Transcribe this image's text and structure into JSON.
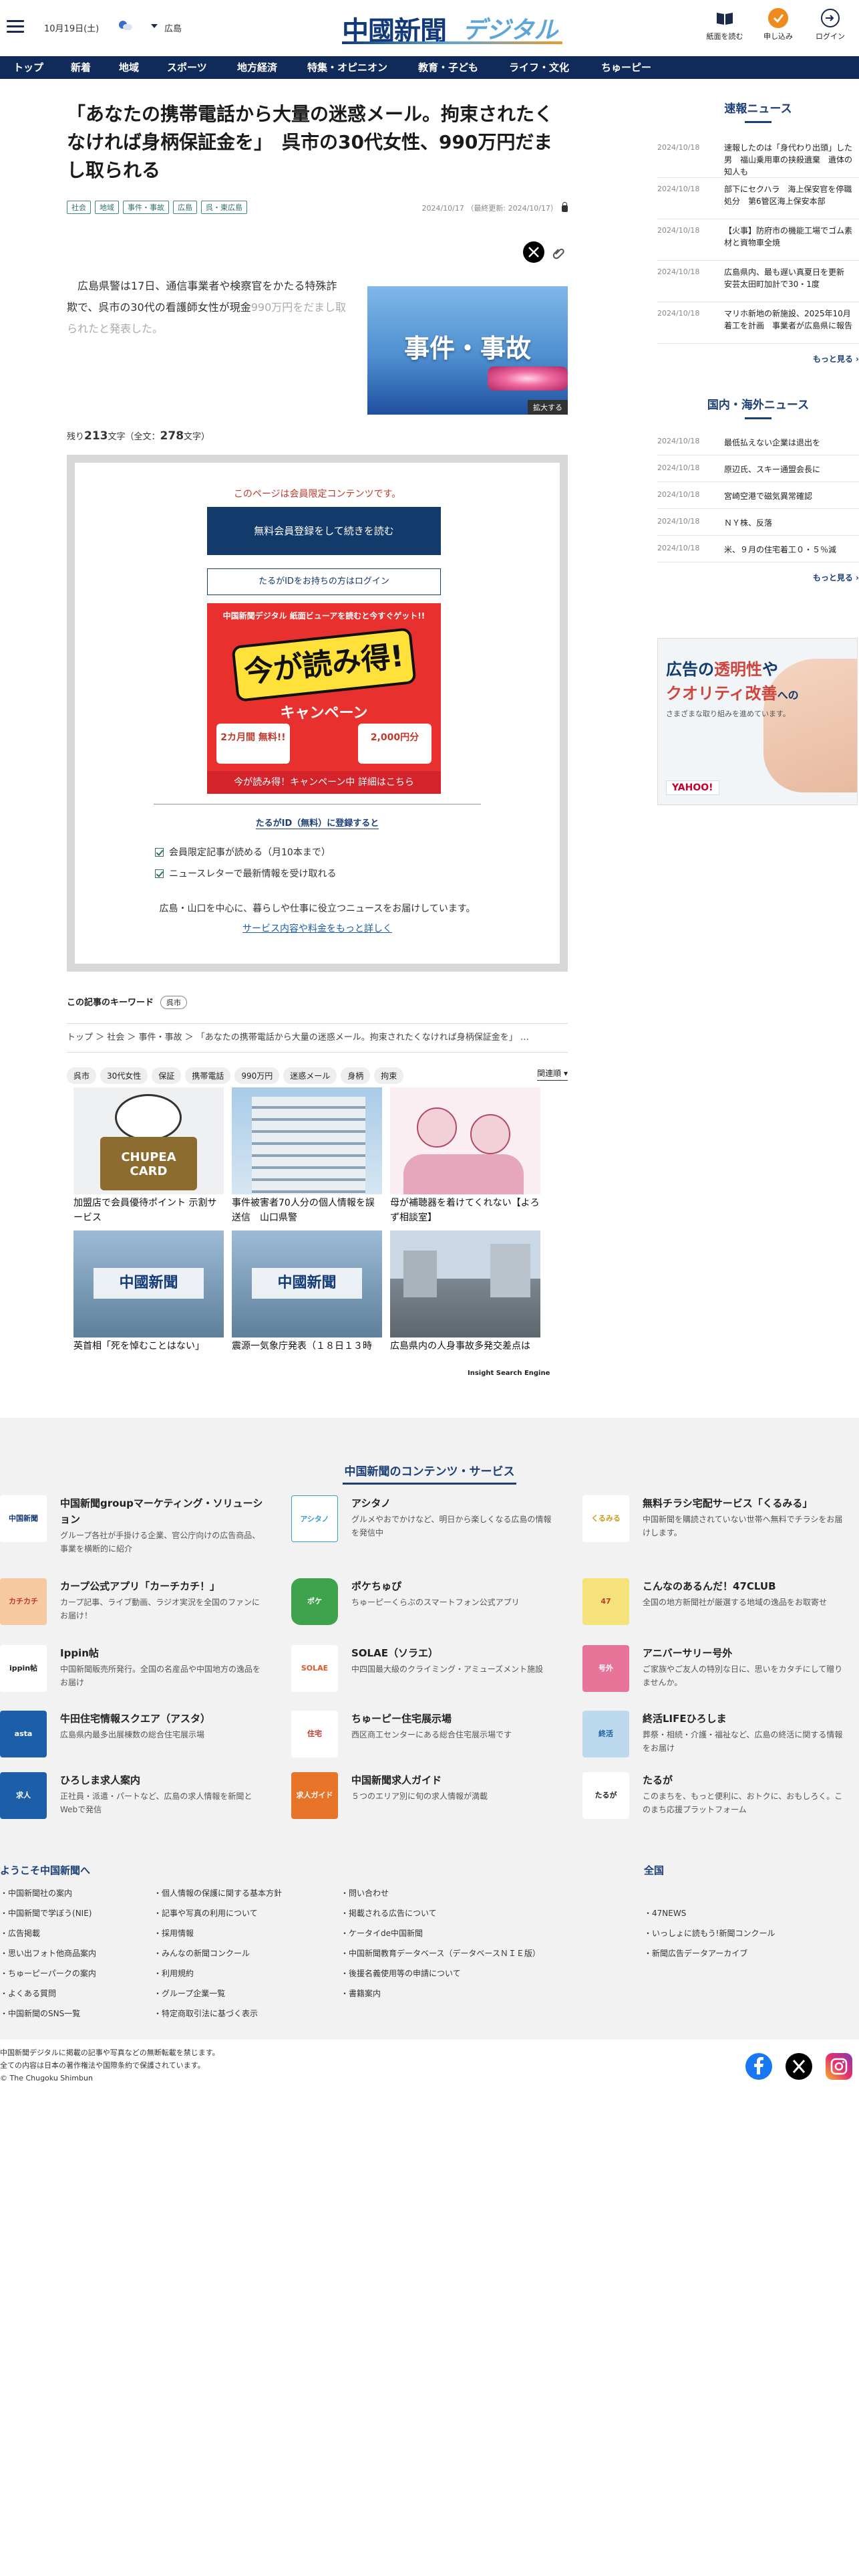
{
  "header": {
    "date": "10月19日(土)",
    "region": "広島",
    "logo_kanji": "中國新聞",
    "logo_digital": "デジタル",
    "tools": [
      {
        "label": "紙面を読む",
        "icon": "book-icon"
      },
      {
        "label": "申し込み",
        "icon": "apply-icon"
      },
      {
        "label": "ログイン",
        "icon": "login-icon"
      }
    ]
  },
  "nav": {
    "items": [
      "トップ",
      "新着",
      "地域",
      "スポーツ",
      "地方経済",
      "特集・オピニオン",
      "教育・子ども",
      "ライフ・文化",
      "ちゅーピー"
    ]
  },
  "article": {
    "title": "「あなたの携帯電話から大量の迷惑メール。拘束されたくなければ身柄保証金を」　呉市の30代女性、990万円だまし取られる",
    "tags": [
      "社会",
      "地域",
      "事件・事故",
      "広島",
      "呉・東広島"
    ],
    "date": "2024/10/17",
    "updated": "（最終更新: 2024/10/17）",
    "lead_1": "　広島県警は17日、通信事業者や検察官をかたる特殊詐欺で、呉市の30代の看護師女性が現金",
    "lead_2": "990万円をだまし取られたと発表した。",
    "photo_text": "事件・事故",
    "photo_zoom": "拡大する",
    "remain_prefix": "残り",
    "remain_count": "213",
    "remain_suffix": "文字（全文：",
    "total_count": "278",
    "total_suffix": "文字）"
  },
  "paywall": {
    "message": "このページは会員限定コンテンツです。",
    "register_button": "無料会員登録をして続きを読む",
    "login_button": "たるがIDをお持ちの方はログイン",
    "banner_top": "中国新聞デジタル 紙面ビューアを読むと今すぐゲット!!",
    "banner_big": "今が読み得!",
    "banner_campaign": "キャンペーン",
    "banner_left": "2カ月間 無料!!",
    "banner_right": "2,000円分",
    "banner_bottom": "今が読み得！キャンペーン中 詳細はこちら",
    "register_heading": "たるがID（無料）に登録すると",
    "benefit_1": "会員限定記事が読める（月10本まで）",
    "benefit_2": "ニュースレターで最新情報を受け取れる",
    "note": "広島・山口を中心に、暮らしや仕事に役立つニュースをお届けしています。",
    "more_link": "サービス内容や料金をもっと詳しく"
  },
  "keywords": {
    "label": "この記事のキーワード",
    "items": [
      "呉市"
    ]
  },
  "breadcrumb": "トップ ＞ 社会 ＞ 事件・事故 ＞ 「あなたの携帯電話から大量の迷惑メール。拘束されたくなければ身柄保証金を」 …",
  "post_tags": [
    "呉市",
    "30代女性",
    "保証",
    "携帯電話",
    "990万円",
    "迷惑メール",
    "身柄",
    "拘束"
  ],
  "related_label": "関連順",
  "related": [
    {
      "caption": "加盟店で会員優待ポイント 示割サービス",
      "img": "chupea-card"
    },
    {
      "caption": "事件被害者70人分の個人情報を誤送信　山口県警",
      "img": "building"
    },
    {
      "caption": "母が補聴器を着けてくれない【よろず相談室】",
      "img": "illustration"
    },
    {
      "caption": "英首相「死を悼むことはない」",
      "img": "aerial"
    },
    {
      "caption": "震源一気象庁発表（１８日１３時",
      "img": "aerial"
    },
    {
      "caption": "広島県内の人身事故多発交差点は",
      "img": "street"
    }
  ],
  "insight_label": "Insight Search Engine",
  "sidebar": {
    "flash_title": "速報ニュース",
    "flash": [
      {
        "date": "2024/10/18",
        "title": "速報したのは「身代わり出頭」した男　福山乗用車の挟殺遺棄　遺体の知人も",
        "fixed": false
      },
      {
        "date": "2024/10/18",
        "title": "部下にセクハラ　海上保安官を停職処分　第6管区海上保安本部"
      },
      {
        "date": "2024/10/18",
        "title": "【火事】防府市の機能工場でゴム素材と資物車全焼"
      },
      {
        "date": "2024/10/18",
        "title": "広島県内、最も遅い真夏日を更新　安芸太田町加計で30・1度"
      },
      {
        "date": "2024/10/18",
        "title": "マリホ新地の新施設、2025年10月着工を計画　事業者が広島県に報告"
      }
    ],
    "flash_more": "もっと見る",
    "world_title": "国内・海外ニュース",
    "world": [
      {
        "date": "2024/10/18",
        "title": "最低払えない企業は退出を"
      },
      {
        "date": "2024/10/18",
        "title": "原辺氏、スキー通盟会長に"
      },
      {
        "date": "2024/10/18",
        "title": "宮崎空港で磁気異常確認"
      },
      {
        "date": "2024/10/18",
        "title": "ＮＹ株、反落"
      },
      {
        "date": "2024/10/18",
        "title": "米、９月の住宅着工０・５％減"
      }
    ],
    "world_more": "もっと見る",
    "ad_line1a": "広告の",
    "ad_line1b": "透明性",
    "ad_line1c": "や",
    "ad_line2a": "クオリティ改善",
    "ad_line2b": "への",
    "ad_line3": "さまざまな取り組みを進めています。",
    "ad_brand": "YAHOO!"
  },
  "footer": {
    "title": "中国新聞のコンテンツ・サービス",
    "services": [
      {
        "name": "中国新聞groupマーケティング・ソリューション",
        "desc": "グループ各社が手掛ける企業、官公庁向けの広告商品、事業を横断的に紹介",
        "icon": "marketing-logo",
        "color": "#ffffff"
      },
      {
        "name": "アシタノ",
        "desc": "グルメやおでかけなど、明日から楽しくなる広島の情報を発信中",
        "icon": "ashitano-logo",
        "color": "#ffffff"
      },
      {
        "name": "無料チラシ宅配サービス「くるみる」",
        "desc": "中国新聞を購読されていない世帯へ無料でチラシをお届けします。",
        "icon": "kurumiru-logo",
        "color": "#ffffff"
      },
      {
        "name": "カープ公式アプリ「カーチカチ！」",
        "desc": "カープ記事、ライブ動画、ラジオ実況を全国のファンにお届け！",
        "icon": "carp-app-logo",
        "color": "#f7c9a0"
      },
      {
        "name": "ポケちゅぴ",
        "desc": "ちゅーピーくらぶのスマートフォン公式アプリ",
        "icon": "pokechupi-logo",
        "color": "#3fa34d"
      },
      {
        "name": "こんなのあるんだ！47CLUB",
        "desc": "全国の地方新聞社が厳選する地域の逸品をお取寄せ",
        "icon": "47club-logo",
        "color": "#f6e27a"
      },
      {
        "name": "Ippin帖",
        "desc": "中国新聞販売所発行。全国の名産品や中国地方の逸品をお届け",
        "icon": "ippin-logo",
        "color": "#ffffff"
      },
      {
        "name": "SOLAE（ソラエ）",
        "desc": "中四国最大級のクライミング・アミューズメント施設",
        "icon": "solae-logo",
        "color": "#ffffff"
      },
      {
        "name": "アニバーサリー号外",
        "desc": "ご家族やご友人の特別な日に、思いをカタチにして贈りませんか。",
        "icon": "anniversary-logo",
        "color": "#e8749a"
      },
      {
        "name": "牛田住宅情報スクエア（アスタ）",
        "desc": "広島県内最多出展棟数の総合住宅展示場",
        "icon": "asta-logo",
        "color": "#1c5fa8"
      },
      {
        "name": "ちゅーピー住宅展示場",
        "desc": "西区商工センターにある総合住宅展示場です",
        "icon": "chupy-house-logo",
        "color": "#ffffff"
      },
      {
        "name": "終活LIFEひろしま",
        "desc": "葬祭・相続・介護・福祉など、広島の終活に関する情報をお届け",
        "icon": "shukatsu-logo",
        "color": "#bcd9ee"
      },
      {
        "name": "ひろしま求人案内",
        "desc": "正社員・派遣・パートなど、広島の求人情報を新聞とWebで発信",
        "icon": "kyujin-logo",
        "color": "#1c5fa8"
      },
      {
        "name": "中国新聞求人ガイド",
        "desc": "５つのエリア別に旬の求人情報が満載",
        "icon": "kyujin-guide-logo",
        "color": "#e8742a"
      },
      {
        "name": "たるが",
        "desc": "このまちを、もっと便利に、おトクに、おもしろく。このまち応援プラットフォーム",
        "icon": "taruga-logo",
        "color": "#ffffff"
      }
    ],
    "links_heading": "ようこそ中国新聞へ",
    "links_col1": [
      "中国新聞社の案内",
      "中国新聞で学ぼう(NIE)",
      "広告掲載",
      "思い出フォト他商品案内",
      "ちゅーピーパークの案内",
      "よくある質問",
      "中国新聞のSNS一覧"
    ],
    "links_col2": [
      "個人情報の保護に関する基本方針",
      "記事や写真の利用について",
      "採用情報",
      "みんなの新聞コンクール",
      "利用規約",
      "グループ企業一覧",
      "特定商取引法に基づく表示"
    ],
    "links_col3": [
      "問い合わせ",
      "掲載される広告について",
      "ケータイde中国新聞",
      "中国新聞教育データベース（データベースＮＩＥ版）",
      "後援名義使用等の申請について",
      "書籍案内"
    ],
    "national_heading": "全国",
    "national": [
      "47NEWS",
      "いっしょに読もう!新聞コンクール",
      "新聞広告データアーカイブ"
    ],
    "copyright_1": "中国新聞デジタルに掲載の記事や写真などの無断転載を禁じます。",
    "copyright_2": "全ての内容は日本の著作権法や国際条約で保護されています。",
    "copyright_3": "© The Chugoku Shimbun"
  }
}
